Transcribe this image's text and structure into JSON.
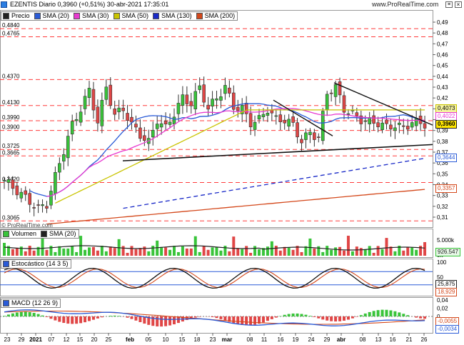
{
  "header": {
    "title": "EZENTIS Diario 0,3960 (+0,51%) 30-abr-2021 17:35:01",
    "brand": "www.ProRealTime.com",
    "watermark": "© ProRealTime.com"
  },
  "price_panel": {
    "legend": [
      {
        "label": "Precio",
        "color": "#222222"
      },
      {
        "label": "SMA (20)",
        "color": "#2a5bd7"
      },
      {
        "label": "SMA (30)",
        "color": "#e83ad0"
      },
      {
        "label": "SMA (50)",
        "color": "#c9c400"
      },
      {
        "label": "SMA (130)",
        "color": "#1a2ac8"
      },
      {
        "label": "SMA (200)",
        "color": "#d4481b"
      }
    ],
    "right_ticks": [
      "0,49",
      "0,48",
      "0,47",
      "0,46",
      "0,45",
      "0,44",
      "0,43",
      "0,42",
      "0,41",
      "0,40",
      "0,39",
      "0,38",
      "0,37",
      "0,36",
      "0,35",
      "0,34",
      "0,33",
      "0,32",
      "0,31"
    ],
    "left_levels": [
      "0,4840",
      "0,4765",
      "0,4370",
      "0,4130",
      "0,3990",
      "0,3900",
      "0,3725",
      "0,3665",
      "0,3420",
      "0,3065"
    ],
    "tags": [
      {
        "label": "0,4073",
        "color": "#c9c400"
      },
      {
        "label": "0,4022",
        "color": "#e83ad0"
      },
      {
        "label": "0,3960",
        "color": "#222222"
      },
      {
        "label": "0,3644",
        "color": "#2a5bd7"
      },
      {
        "label": "0,3357",
        "color": "#d4481b"
      }
    ]
  },
  "volume_panel": {
    "legend": [
      {
        "label": "Volumen",
        "color": "#39c43a"
      },
      {
        "label": "SMA (20)",
        "color": "#222222"
      }
    ],
    "right_ticks": [
      "5.000k",
      "0k"
    ],
    "tag": "926.547"
  },
  "stoch_panel": {
    "legend": [
      {
        "label": "Estocástico (14 3 5)",
        "color": "#2a5bd7"
      }
    ],
    "right_ticks": [
      "100",
      "50",
      "0"
    ],
    "tags": [
      {
        "label": "25,875",
        "color": "#222222"
      },
      {
        "label": "18,929",
        "color": "#d4481b"
      }
    ]
  },
  "macd_panel": {
    "legend": [
      {
        "label": "MACD (12 26 9)",
        "color": "#2a5bd7"
      }
    ],
    "right_ticks": [
      "0,04",
      "0,02",
      "0",
      "-0,02"
    ],
    "tags": [
      {
        "label": "-0,0055",
        "color": "#d4481b"
      },
      {
        "label": "-0,0034",
        "color": "#2a5bd7"
      }
    ]
  },
  "x_axis": [
    "23",
    "29",
    "2021",
    "07",
    "12",
    "15",
    "20",
    "25",
    "feb",
    "05",
    "10",
    "15",
    "18",
    "23",
    "mar",
    "08",
    "11",
    "16",
    "19",
    "24",
    "29",
    "abr",
    "08",
    "13",
    "16",
    "21",
    "26",
    "29"
  ],
  "chart_data": {
    "type": "candlestick",
    "title": "EZENTIS Diario 0,3960 (+0,51%) 30-abr-2021 17:35:01",
    "ylim": [
      0.3,
      0.49
    ],
    "series": [
      {
        "name": "SMA (20)",
        "last": 0.396
      },
      {
        "name": "SMA (30)",
        "last": 0.4022
      },
      {
        "name": "SMA (50)",
        "last": 0.4073
      },
      {
        "name": "SMA (130)",
        "last": 0.3644
      },
      {
        "name": "SMA (200)",
        "last": 0.3357
      }
    ],
    "close_last": 0.396,
    "volume_sma20_last": 926547,
    "stochastic": {
      "k": 25.875,
      "d": 18.929
    },
    "macd": {
      "macd": -0.0034,
      "signal": -0.0055
    }
  }
}
